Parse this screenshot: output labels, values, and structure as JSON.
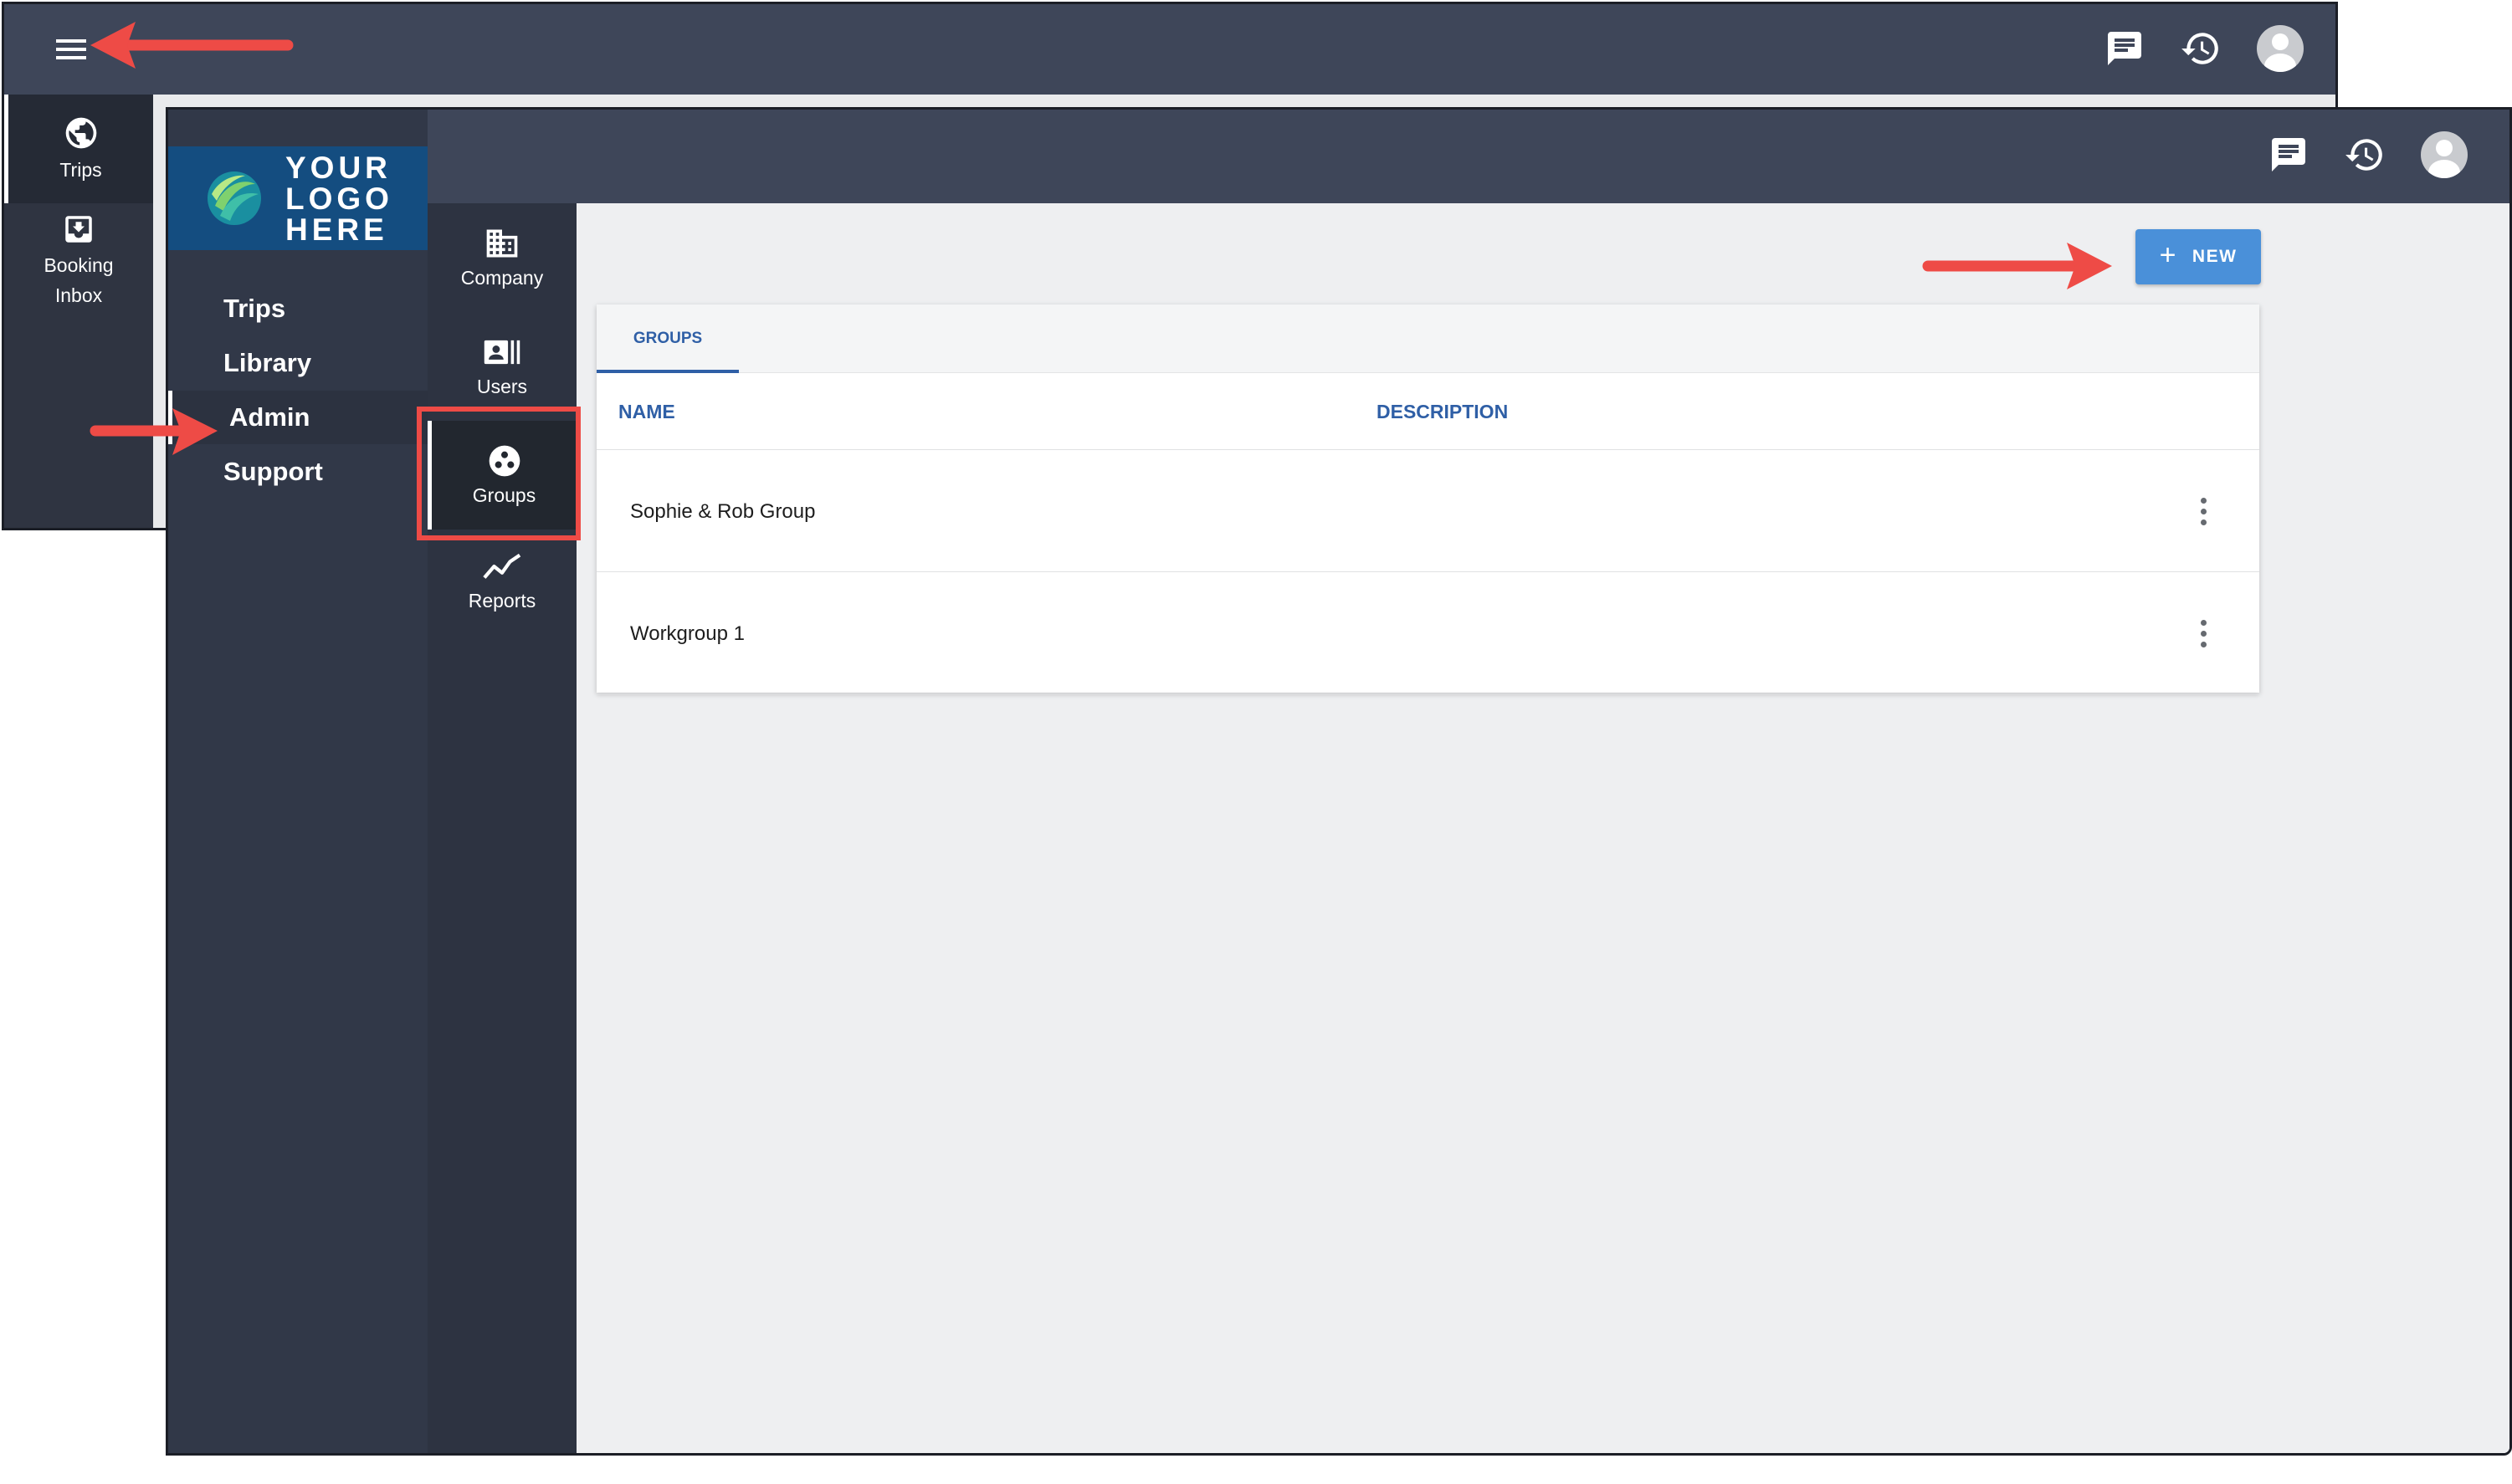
{
  "back_window": {
    "rail": [
      {
        "label": "Trips",
        "icon": "globe-icon"
      },
      {
        "label": "Booking",
        "label2": "Inbox",
        "icon": "inbox-icon"
      }
    ]
  },
  "front_window": {
    "logo": {
      "line1": "YOUR",
      "line2": "LOGO",
      "line3": "HERE"
    },
    "nav": [
      "Trips",
      "Library",
      "Admin",
      "Support"
    ],
    "admin_rail": [
      {
        "label": "Company",
        "icon": "building-icon"
      },
      {
        "label": "Users",
        "icon": "user-card-icon"
      },
      {
        "label": "Groups",
        "icon": "groups-icon"
      },
      {
        "label": "Reports",
        "icon": "chart-line-icon"
      }
    ],
    "new_button": {
      "label": "NEW"
    },
    "tab": "GROUPS",
    "table": {
      "headers": [
        "NAME",
        "DESCRIPTION"
      ],
      "rows": [
        {
          "name": "Sophie & Rob Group",
          "description": ""
        },
        {
          "name": "Workgroup 1",
          "description": ""
        }
      ]
    }
  },
  "colors": {
    "topbar": "#3e4659",
    "sidebar": "#313848",
    "accent": "#2f5fa6",
    "button": "#4a90d9",
    "annotation": "#ee4b46"
  }
}
